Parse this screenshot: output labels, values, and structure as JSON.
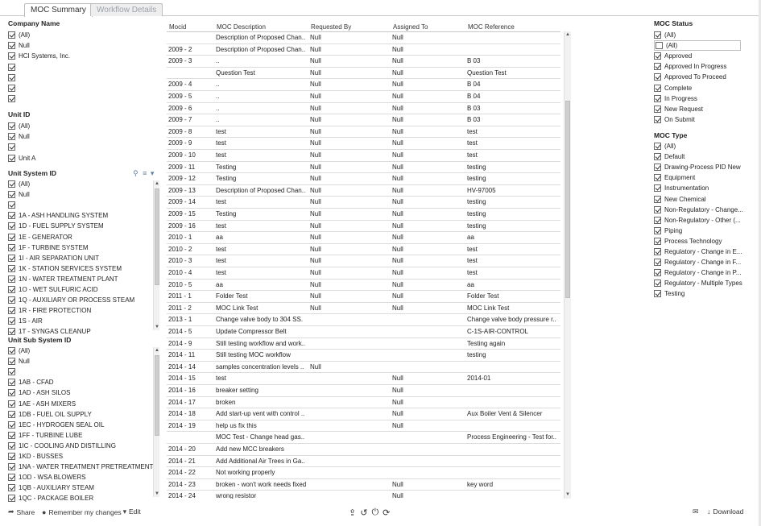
{
  "tabs": [
    {
      "label": "MOC Summary",
      "active": true
    },
    {
      "label": "Workflow Details",
      "active": false
    }
  ],
  "filters": {
    "company_name": {
      "title": "Company Name",
      "items": [
        {
          "label": "(All)",
          "checked": true
        },
        {
          "label": "Null",
          "checked": true
        },
        {
          "label": "HCI Systems, Inc.",
          "checked": true
        },
        {
          "label": "",
          "checked": true
        },
        {
          "label": "",
          "checked": true
        },
        {
          "label": "",
          "checked": true
        },
        {
          "label": "",
          "checked": true
        }
      ]
    },
    "unit_id": {
      "title": "Unit ID",
      "items": [
        {
          "label": "(All)",
          "checked": true
        },
        {
          "label": "Null",
          "checked": true
        },
        {
          "label": "",
          "checked": true
        },
        {
          "label": "Unit A",
          "checked": true
        }
      ]
    },
    "unit_system_id": {
      "title": "Unit System ID",
      "items": [
        {
          "label": "(All)",
          "checked": true
        },
        {
          "label": "Null",
          "checked": true
        },
        {
          "label": "",
          "checked": true
        },
        {
          "label": "1A - ASH HANDLING SYSTEM",
          "checked": true
        },
        {
          "label": "1D - FUEL SUPPLY SYSTEM",
          "checked": true
        },
        {
          "label": "1E - GENERATOR",
          "checked": true
        },
        {
          "label": "1F - TURBINE SYSTEM",
          "checked": true
        },
        {
          "label": "1I - AIR SEPARATION UNIT",
          "checked": true
        },
        {
          "label": "1K - STATION SERVICES SYSTEM",
          "checked": true
        },
        {
          "label": "1N - WATER TREATMENT PLANT",
          "checked": true
        },
        {
          "label": "1O - WET SULFURIC ACID",
          "checked": true
        },
        {
          "label": "1Q - AUXILIARY OR PROCESS STEAM",
          "checked": true
        },
        {
          "label": "1R - FIRE PROTECTION",
          "checked": true
        },
        {
          "label": "1S - AIR",
          "checked": true
        },
        {
          "label": "1T - SYNGAS CLEANUP",
          "checked": true
        }
      ]
    },
    "unit_sub_system_id": {
      "title": "Unit Sub System ID",
      "items": [
        {
          "label": "(All)",
          "checked": true
        },
        {
          "label": "Null",
          "checked": true
        },
        {
          "label": "",
          "checked": true
        },
        {
          "label": "1AB - CFAD",
          "checked": true
        },
        {
          "label": "1AD - ASH SILOS",
          "checked": true
        },
        {
          "label": "1AE - ASH MIXERS",
          "checked": true
        },
        {
          "label": "1DB - FUEL OIL SUPPLY",
          "checked": true
        },
        {
          "label": "1EC - HYDROGEN SEAL OIL",
          "checked": true
        },
        {
          "label": "1FF - TURBINE LUBE",
          "checked": true
        },
        {
          "label": "1IC - COOLING AND DISTILLING",
          "checked": true
        },
        {
          "label": "1KD - BUSSES",
          "checked": true
        },
        {
          "label": "1NA - WATER TREATMENT PRETREATMENT",
          "checked": true
        },
        {
          "label": "1OD - WSA BLOWERS",
          "checked": true
        },
        {
          "label": "1QB - AUXILIARY STEAM",
          "checked": true
        },
        {
          "label": "1QC - PACKAGE BOILER",
          "checked": true
        }
      ]
    },
    "moc_status": {
      "title": "MOC Status",
      "items": [
        {
          "label": "(All)",
          "checked": true
        },
        {
          "label": "(All)",
          "checked": false
        },
        {
          "label": "Approved",
          "checked": true
        },
        {
          "label": "Approved In Progress",
          "checked": true
        },
        {
          "label": "Approved To Proceed",
          "checked": true
        },
        {
          "label": "Complete",
          "checked": true
        },
        {
          "label": "In Progress",
          "checked": true
        },
        {
          "label": "New Request",
          "checked": true
        },
        {
          "label": "On Submit",
          "checked": true
        }
      ]
    },
    "moc_type": {
      "title": "MOC Type",
      "items": [
        {
          "label": "(All)",
          "checked": true
        },
        {
          "label": "Default",
          "checked": true
        },
        {
          "label": "Drawing-Process PID New",
          "checked": true
        },
        {
          "label": "Equipment",
          "checked": true
        },
        {
          "label": "Instrumentation",
          "checked": true
        },
        {
          "label": "New Chemical",
          "checked": true
        },
        {
          "label": "Non-Regulatory - Change...",
          "checked": true
        },
        {
          "label": "Non-Regulatory - Other (...",
          "checked": true
        },
        {
          "label": "Piping",
          "checked": true
        },
        {
          "label": "Process Technology",
          "checked": true
        },
        {
          "label": "Regulatory - Change in E...",
          "checked": true
        },
        {
          "label": "Regulatory - Change in F...",
          "checked": true
        },
        {
          "label": "Regulatory - Change in P...",
          "checked": true
        },
        {
          "label": "Regulatory - Multiple Types",
          "checked": true
        },
        {
          "label": "Testing",
          "checked": true
        }
      ]
    }
  },
  "table": {
    "columns": [
      "Mocid",
      "MOC Description",
      "Requested By",
      "Assigned To",
      "MOC Reference"
    ],
    "rows": [
      [
        "",
        "Description of Proposed Chan..",
        "Null",
        "Null",
        ""
      ],
      [
        "2009 - 2",
        "Description of Proposed Chan..",
        "Null",
        "Null",
        ""
      ],
      [
        "2009 - 3",
        "..",
        "Null",
        "Null",
        "B 03"
      ],
      [
        "",
        "Question Test",
        "Null",
        "Null",
        "Question Test"
      ],
      [
        "2009 - 4",
        "..",
        "Null",
        "Null",
        "B 04"
      ],
      [
        "2009 - 5",
        "..",
        "Null",
        "Null",
        "B 04"
      ],
      [
        "2009 - 6",
        "..",
        "Null",
        "Null",
        "B 03"
      ],
      [
        "2009 - 7",
        "..",
        "Null",
        "Null",
        "B 03"
      ],
      [
        "2009 - 8",
        "test",
        "Null",
        "Null",
        "test"
      ],
      [
        "2009 - 9",
        "test",
        "Null",
        "Null",
        "test"
      ],
      [
        "2009 - 10",
        "test",
        "Null",
        "Null",
        "test"
      ],
      [
        "2009 - 11",
        "Testing",
        "Null",
        "Null",
        "testing"
      ],
      [
        "2009 - 12",
        "Testing",
        "Null",
        "Null",
        "testing"
      ],
      [
        "2009 - 13",
        "Description of Proposed Chan..",
        "Null",
        "Null",
        "HV-97005"
      ],
      [
        "2009 - 14",
        "test",
        "Null",
        "Null",
        "testing"
      ],
      [
        "2009 - 15",
        "Testing",
        "Null",
        "Null",
        "testing"
      ],
      [
        "2009 - 16",
        "test",
        "Null",
        "Null",
        "testing"
      ],
      [
        "2010 - 1",
        "aa",
        "Null",
        "Null",
        "aa"
      ],
      [
        "2010 - 2",
        "test",
        "Null",
        "Null",
        "test"
      ],
      [
        "2010 - 3",
        "test",
        "Null",
        "Null",
        "test"
      ],
      [
        "2010 - 4",
        "test",
        "Null",
        "Null",
        "test"
      ],
      [
        "2010 - 5",
        "aa",
        "Null",
        "Null",
        "aa"
      ],
      [
        "2011 - 1",
        "Folder Test",
        "Null",
        "Null",
        "Folder Test"
      ],
      [
        "2011 - 2",
        "MOC Link Test",
        "Null",
        "Null",
        "MOC Link Test"
      ],
      [
        "2013 - 1",
        "Change valve body to 304 SS.",
        "",
        "",
        "Change valve body pressure r.."
      ],
      [
        "2014 - 5",
        "Update Compressor Belt",
        "",
        "",
        "C-1S-AIR-CONTROL"
      ],
      [
        "2014 - 9",
        "Still testing workflow and work..",
        "",
        "",
        "Testing again"
      ],
      [
        "2014 - 11",
        "Still testing MOC workflow",
        "",
        "",
        "testing"
      ],
      [
        "2014 - 14",
        "samples concentration levels ..",
        "Null",
        "",
        ""
      ],
      [
        "2014 - 15",
        "test",
        "",
        "Null",
        "2014-01"
      ],
      [
        "2014 - 16",
        "breaker setting",
        "",
        "Null",
        ""
      ],
      [
        "2014 - 17",
        "broken",
        "",
        "Null",
        ""
      ],
      [
        "2014 - 18",
        "Add start-up vent with control ..",
        "",
        "Null",
        "Aux Boiler Vent & Silencer"
      ],
      [
        "2014 - 19",
        "help us fix this",
        "",
        "Null",
        ""
      ],
      [
        "",
        "MOC Test - Change head gas..",
        "",
        "",
        "Process Engineering - Test for.."
      ],
      [
        "2014 - 20",
        "Add new MCC breakers",
        "",
        "",
        ""
      ],
      [
        "2014 - 21",
        "Add Additional Air Trees in Ga..",
        "",
        "",
        ""
      ],
      [
        "2014 - 22",
        "Not working properly",
        "",
        "",
        ""
      ],
      [
        "2014 - 23",
        "broken - won't work needs fixed",
        "",
        "Null",
        "key word"
      ],
      [
        "2014 - 24",
        "wrong resistor",
        "",
        "Null",
        ""
      ]
    ]
  },
  "bottom": {
    "share": "Share",
    "remember": "Remember my changes",
    "edit": "Edit",
    "download": "Download"
  }
}
